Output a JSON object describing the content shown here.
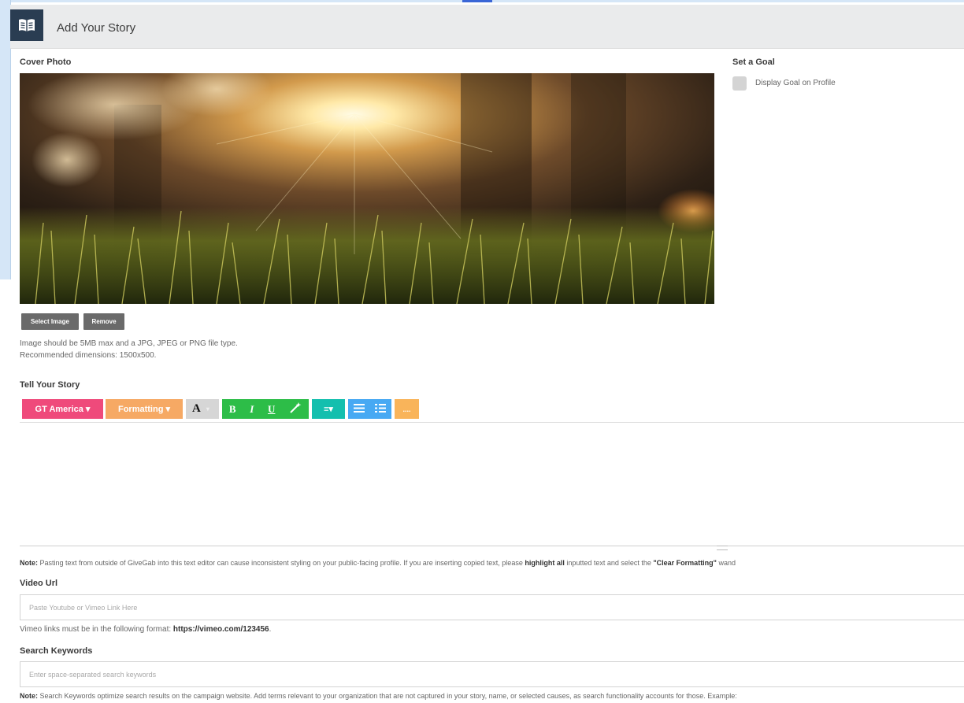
{
  "header": {
    "title": "Add Your Story",
    "icon": "open-book-icon"
  },
  "cover_photo": {
    "label": "Cover Photo",
    "select_label": "Select Image",
    "remove_label": "Remove",
    "help_line1": "Image should be 5MB max and a JPG, JPEG or PNG file type.",
    "help_line2": "Recommended dimensions: 1500x500."
  },
  "goal": {
    "label": "Set a Goal",
    "checkbox_label": "Display Goal on Profile",
    "checked": false
  },
  "story": {
    "label": "Tell Your Story",
    "toolbar": {
      "font": "GT America ▾",
      "formatting": "Formatting ▾",
      "text_color": "A",
      "bold": "B",
      "italic": "I",
      "underline": "U",
      "clear_icon": "magic-wand-icon",
      "align": "≡▾",
      "bullets_icon": "bullet-list-icon",
      "numbers_icon": "numbered-list-icon",
      "more": "...."
    },
    "note_prefix": "Note:",
    "note_text1": " Pasting text from outside of GiveGab into this text editor can cause inconsistent styling on your public-facing profile. If you are inserting copied text, please ",
    "note_bold1": "highlight all",
    "note_text2": " inputted text and select the ",
    "note_bold2": "\"Clear Formatting\"",
    "note_text3": " wand"
  },
  "video": {
    "label": "Video Url",
    "placeholder": "Paste Youtube or Vimeo Link Here",
    "help_prefix": "Vimeo links must be in the following format: ",
    "help_link": "https://vimeo.com/123456",
    "help_suffix": "."
  },
  "keywords": {
    "label": "Search Keywords",
    "placeholder": "Enter space-separated search keywords",
    "note_prefix": "Note:",
    "note_text": " Search Keywords optimize search results on the campaign website. Add terms relevant to your organization that are not captured in your story, name, or selected causes, as search functionality accounts for those. Example:"
  },
  "colors": {
    "header_bg": "#eaebec",
    "header_icon_bg": "#2a3d52",
    "font_btn": "#ef4a7b",
    "formatting_btn": "#f6a964",
    "color_btn": "#d6d6d6",
    "style_btn": "#2dbd48",
    "align_btn": "#14bfae",
    "list_btn": "#47a9f3",
    "more_btn": "#f9b45a"
  }
}
